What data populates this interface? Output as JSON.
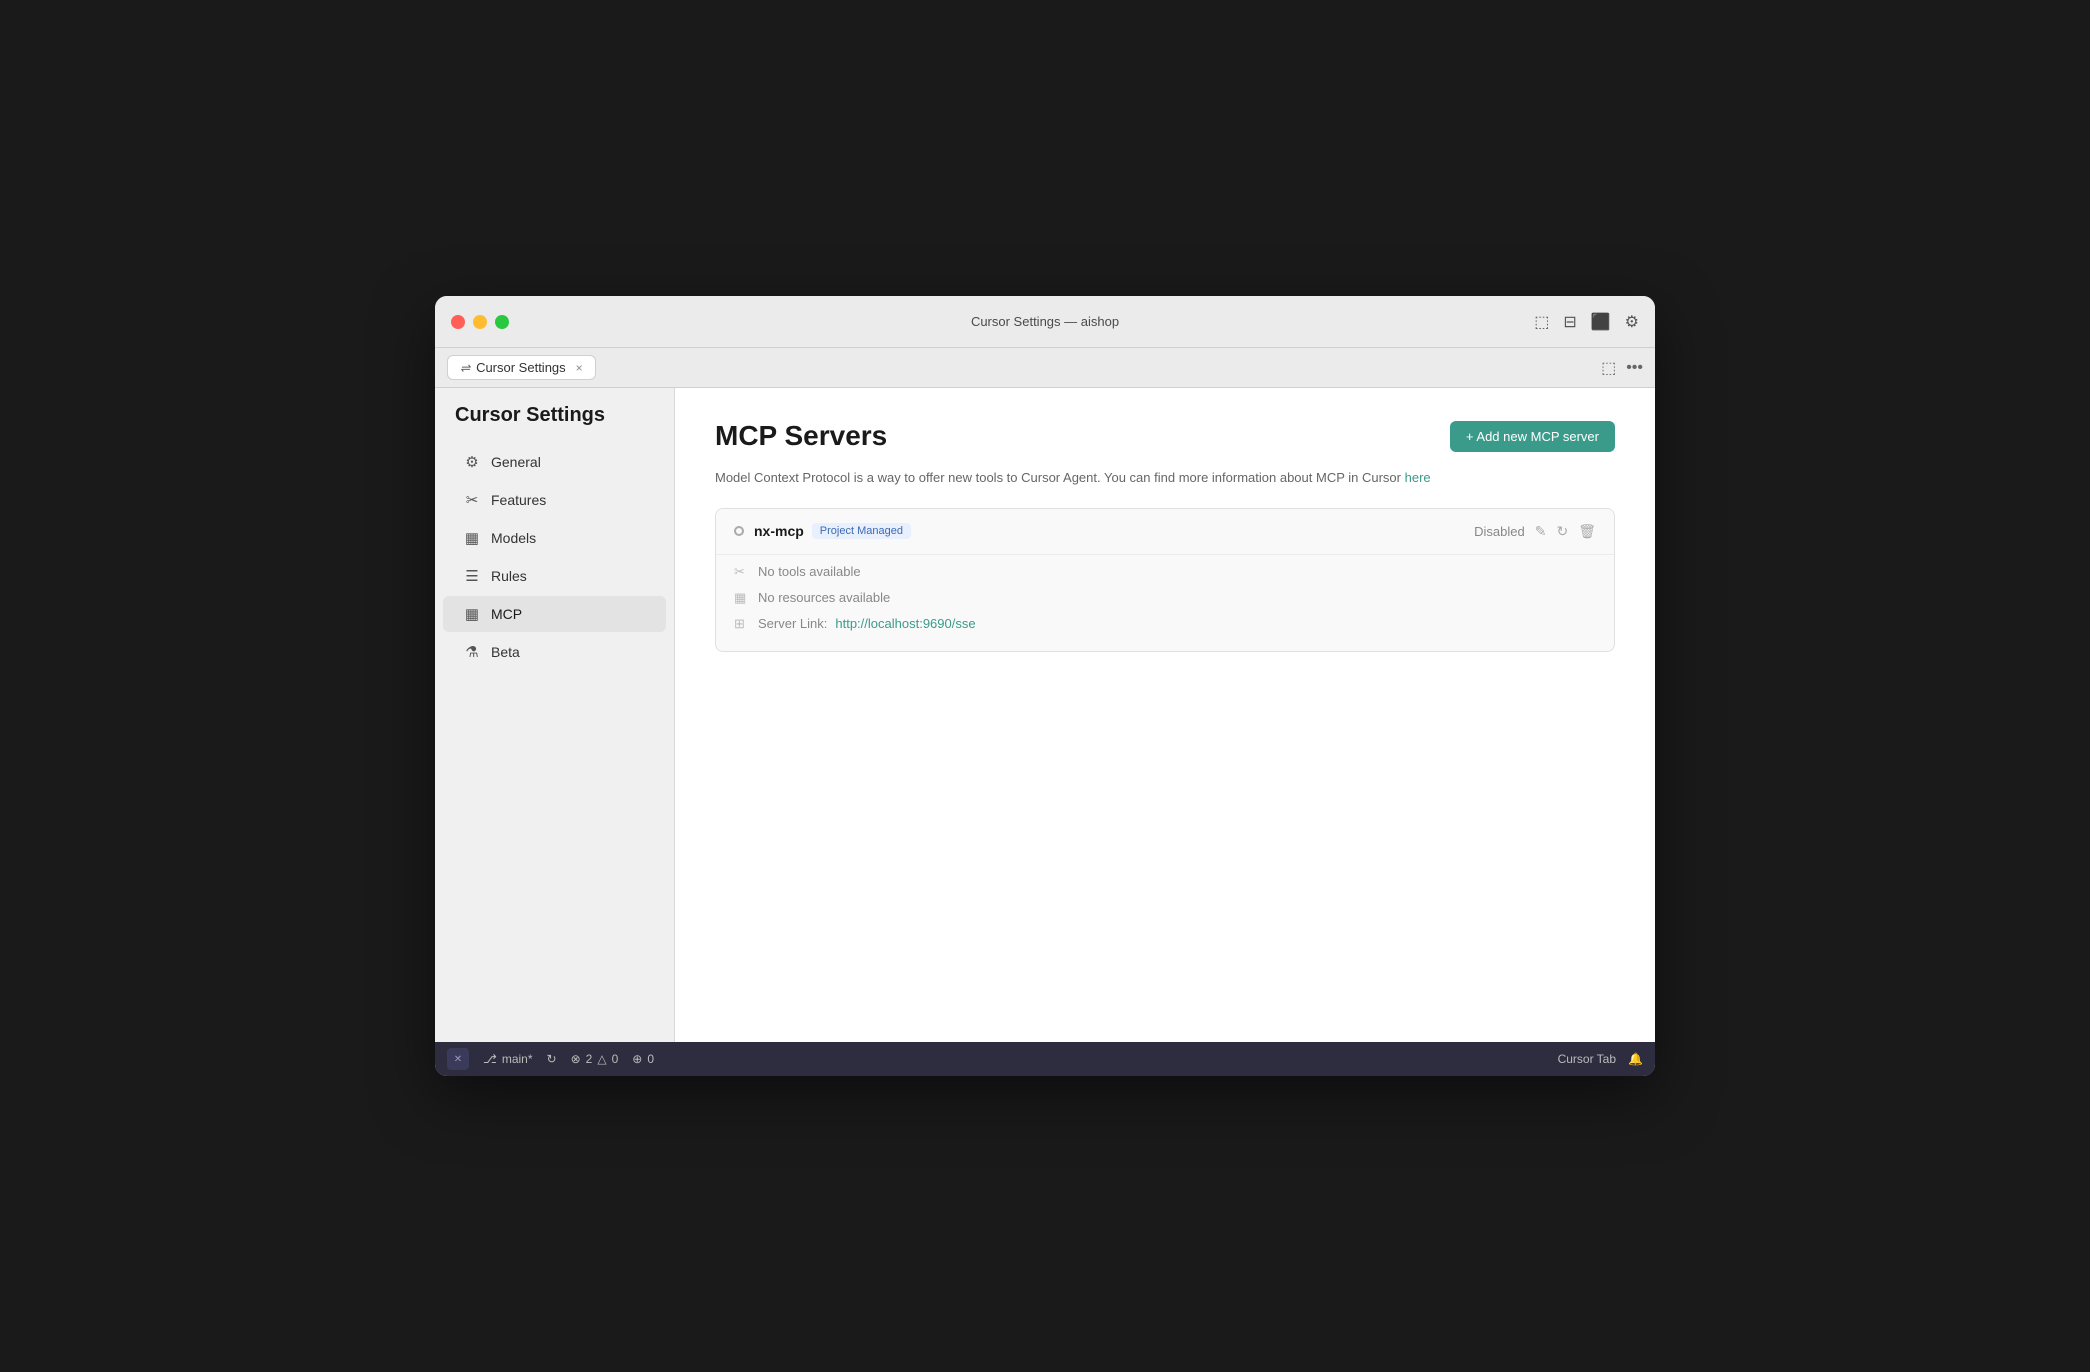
{
  "window": {
    "title": "Cursor Settings — aishop"
  },
  "tab": {
    "icon": "⇌",
    "label": "Cursor Settings",
    "close": "×"
  },
  "sidebar": {
    "title": "Cursor Settings",
    "items": [
      {
        "id": "general",
        "icon": "⚙",
        "label": "General"
      },
      {
        "id": "features",
        "icon": "✂",
        "label": "Features"
      },
      {
        "id": "models",
        "icon": "▦",
        "label": "Models"
      },
      {
        "id": "rules",
        "icon": "☰",
        "label": "Rules"
      },
      {
        "id": "mcp",
        "icon": "▦",
        "label": "MCP",
        "active": true
      },
      {
        "id": "beta",
        "icon": "⚗",
        "label": "Beta"
      }
    ]
  },
  "content": {
    "title": "MCP Servers",
    "description": "Model Context Protocol is a way to offer new tools to Cursor Agent. You can find more information about MCP in Cursor",
    "description_link": "here",
    "add_button": "+ Add new MCP server",
    "servers": [
      {
        "name": "nx-mcp",
        "badge": "Project Managed",
        "status": "Disabled",
        "tools_label": "No tools available",
        "resources_label": "No resources available",
        "server_link_label": "Server Link:",
        "server_link_url": "http://localhost:9690/sse"
      }
    ]
  },
  "statusbar": {
    "branch": "main*",
    "sync_icon": "↻",
    "error_count": "2",
    "warning_count": "0",
    "ai_count": "0",
    "cursor_tab": "Cursor Tab",
    "bell_icon": "🔔"
  },
  "icons": {
    "layout1": "⬚",
    "layout2": "⊟",
    "layout3": "⬛",
    "gear": "⚙",
    "more": "···",
    "branch": "⎇",
    "error": "⊗",
    "warning": "△",
    "ai": "⊕"
  }
}
